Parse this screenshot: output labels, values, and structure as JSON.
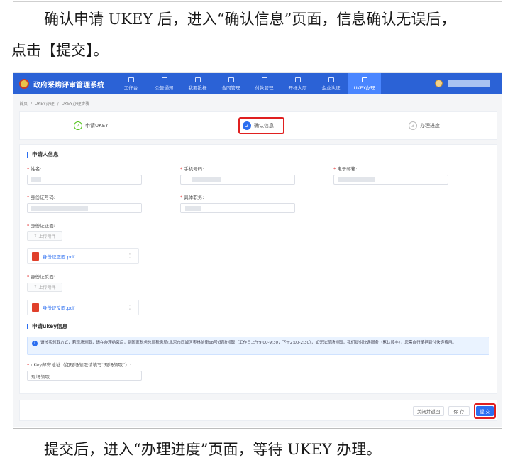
{
  "doc": {
    "para1": "确认申请 UKEY 后，进入“确认信息”页面，信息确认无误后，",
    "para2": "点击【提交】。",
    "para3": "提交后，进入“办理进度”页面，等待 UKEY 办理。"
  },
  "app": {
    "title": "政府采购评审管理系统",
    "nav": [
      {
        "label": "工作台",
        "icon": "dashboard-icon"
      },
      {
        "label": "公告通知",
        "icon": "notice-icon"
      },
      {
        "label": "我要投标",
        "icon": "bid-icon"
      },
      {
        "label": "合同管理",
        "icon": "contract-icon"
      },
      {
        "label": "付款管理",
        "icon": "payment-icon"
      },
      {
        "label": "开标大厅",
        "icon": "hall-icon"
      },
      {
        "label": "企业认证",
        "icon": "verify-icon"
      },
      {
        "label": "UKEY办理",
        "icon": "ukey-icon"
      }
    ],
    "active_nav": "UKEY办理",
    "breadcrumb": [
      "首页",
      "/",
      "UKEY办理",
      "/",
      "UKEY办理步骤"
    ]
  },
  "steps": [
    {
      "label": "申请UKEY",
      "marker": "✓",
      "state": "done"
    },
    {
      "label": "确认信息",
      "marker": "2",
      "state": "current"
    },
    {
      "label": "办理进度",
      "marker": "3",
      "state": "pending"
    }
  ],
  "form": {
    "applicant_section": "申请人信息",
    "name_label": "姓名:",
    "phone_label": "手机号码:",
    "email_label": "电子邮箱:",
    "id_label": "身份证号码:",
    "position_label": "具体职务:",
    "id_front_label": "身份证正面:",
    "id_back_label": "身份证反面:",
    "upload_label": "上传附件",
    "file_front": "身份证正面.pdf",
    "file_back": "身份证反面.pdf",
    "ukey_section": "申请ukey信息",
    "notice": "请核实领取方式，若现场领取，请在办理结束后，到国家税务总局税务局(北京市西城区枣林前街68号)现场领取（工作日上午9:00-9:30，下午2:00-2:30），如无法现场领取，我们提供快递服务（默认顺丰），您需自行承担到付快递费用。",
    "address_label": "uKey邮寄地址（如现场领取请填写“现场领取”）:",
    "address_value": "现场领取"
  },
  "actions": {
    "close_return": "关闭并返回",
    "save": "保 存",
    "submit": "提 交"
  }
}
